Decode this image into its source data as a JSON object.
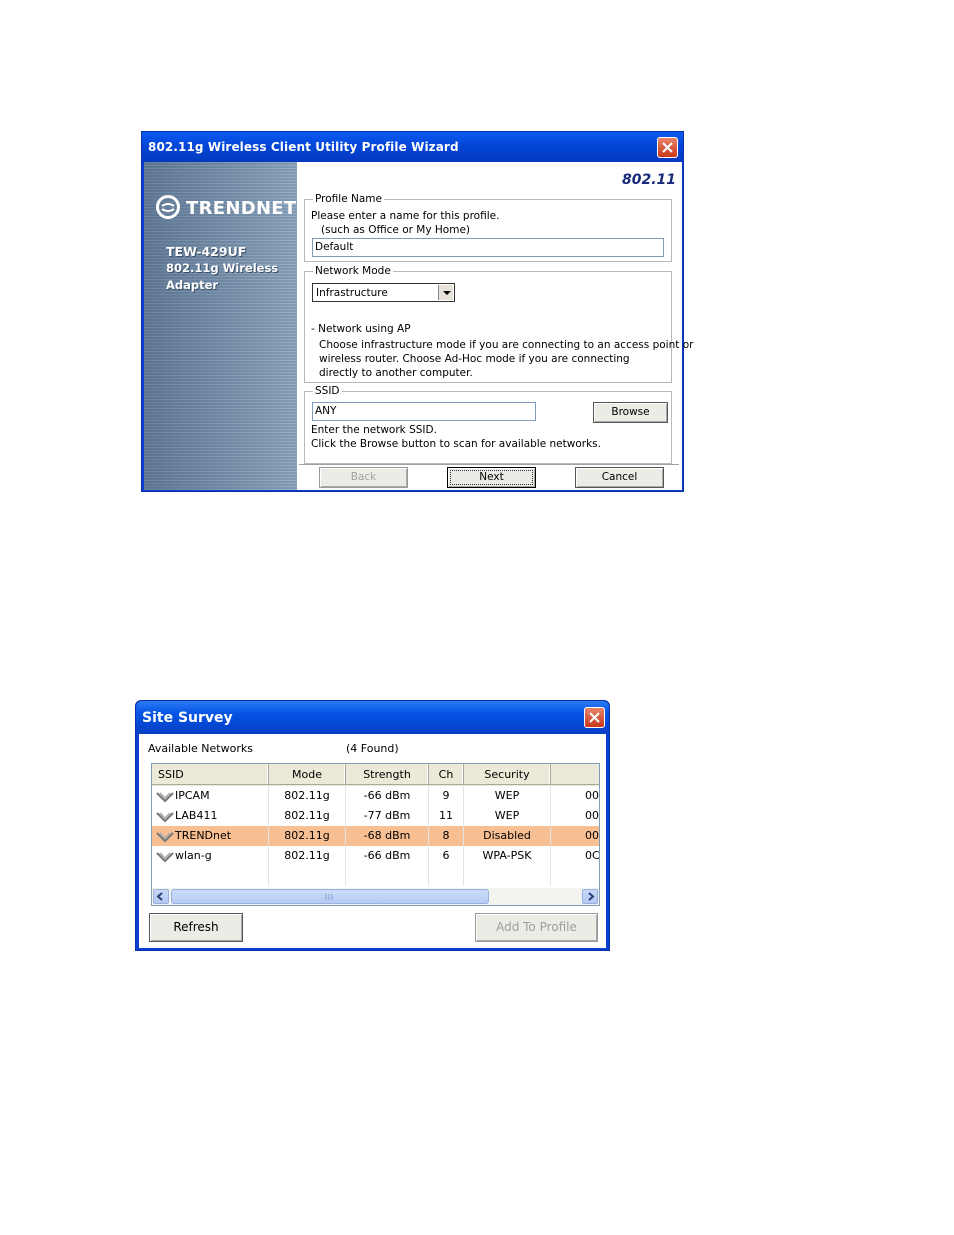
{
  "wizard": {
    "title": "802.11g Wireless Client Utility Profile Wizard",
    "brand_label": "802.11",
    "logo_text": "TRENDNET",
    "product_lines": [
      "TEW-429UF",
      "802.11g Wireless",
      "Adapter"
    ],
    "profile_name": {
      "group_label": "Profile Name",
      "instruction_1": "Please enter a name for this profile.",
      "instruction_2": "(such as Office or My Home)",
      "value": "Default"
    },
    "network_mode": {
      "group_label": "Network Mode",
      "selected": "Infrastructure",
      "desc_title": "- Network using AP",
      "desc_1": "Choose infrastructure mode if you are connecting to an access point or",
      "desc_2": "wireless router. Choose Ad-Hoc mode if you are connecting",
      "desc_3": "directly to another computer."
    },
    "ssid": {
      "group_label": "SSID",
      "value": "ANY",
      "browse_label": "Browse",
      "hint_1": "Enter the network SSID.",
      "hint_2": "Click the Browse button to scan for available networks."
    },
    "buttons": {
      "back": "Back",
      "next": "Next",
      "cancel": "Cancel"
    }
  },
  "survey": {
    "title": "Site Survey",
    "available_label": "Available Networks",
    "found_label": "(4 Found)",
    "columns": [
      "SSID",
      "Mode",
      "Strength",
      "Ch",
      "Security",
      ""
    ],
    "rows": [
      {
        "ssid": "IPCAM",
        "mode": "802.11g",
        "strength": "-66 dBm",
        "ch": "9",
        "security": "WEP",
        "extra": "00",
        "selected": false
      },
      {
        "ssid": "LAB411",
        "mode": "802.11g",
        "strength": "-77 dBm",
        "ch": "11",
        "security": "WEP",
        "extra": "00",
        "selected": false
      },
      {
        "ssid": "TRENDnet",
        "mode": "802.11g",
        "strength": "-68 dBm",
        "ch": "8",
        "security": "Disabled",
        "extra": "00",
        "selected": true
      },
      {
        "ssid": "wlan-g",
        "mode": "802.11g",
        "strength": "-66 dBm",
        "ch": "6",
        "security": "WPA-PSK",
        "extra": "0C",
        "selected": false
      }
    ],
    "refresh_label": "Refresh",
    "add_label": "Add To Profile",
    "colors": {
      "selected_row": "#f7bf92",
      "titlebar": "#0348d4"
    }
  }
}
